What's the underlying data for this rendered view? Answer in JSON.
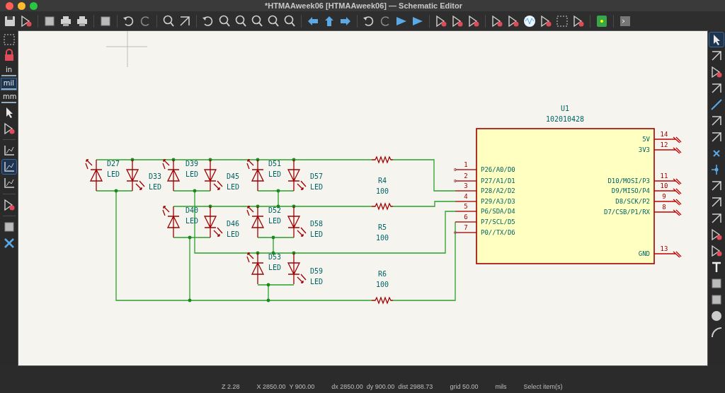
{
  "window": {
    "title": "*HTMAAweek06 [HTMAAweek06] — Schematic Editor"
  },
  "left_toolbar": {
    "units": [
      {
        "label": "in",
        "selected": false
      },
      {
        "label": "mil",
        "selected": true
      },
      {
        "label": "mm",
        "selected": false
      }
    ]
  },
  "schematic": {
    "leds": [
      {
        "ref": "D27",
        "value": "LED"
      },
      {
        "ref": "D33",
        "value": "LED"
      },
      {
        "ref": "D39",
        "value": "LED"
      },
      {
        "ref": "D45",
        "value": "LED"
      },
      {
        "ref": "D51",
        "value": "LED"
      },
      {
        "ref": "D57",
        "value": "LED"
      },
      {
        "ref": "D40",
        "value": "LED"
      },
      {
        "ref": "D46",
        "value": "LED"
      },
      {
        "ref": "D52",
        "value": "LED"
      },
      {
        "ref": "D58",
        "value": "LED"
      },
      {
        "ref": "D53",
        "value": "LED"
      },
      {
        "ref": "D59",
        "value": "LED"
      }
    ],
    "resistors": [
      {
        "ref": "R4",
        "value": "100"
      },
      {
        "ref": "R5",
        "value": "100"
      },
      {
        "ref": "R6",
        "value": "100"
      }
    ],
    "ic": {
      "ref": "U1",
      "value": "102010428",
      "pins_left": [
        {
          "number": "1",
          "name": "P26/A0/D0"
        },
        {
          "number": "2",
          "name": "P27/A1/D1"
        },
        {
          "number": "3",
          "name": "P28/A2/D2"
        },
        {
          "number": "4",
          "name": "P29/A3/D3"
        },
        {
          "number": "5",
          "name": "P6/SDA/D4"
        },
        {
          "number": "6",
          "name": "P7/SCL/D5"
        },
        {
          "number": "7",
          "name": "P0//TX/D6"
        }
      ],
      "pins_right": [
        {
          "number": "14",
          "name": "5V"
        },
        {
          "number": "12",
          "name": "3V3"
        },
        {
          "number": "11",
          "name": "D10/MOSI/P3"
        },
        {
          "number": "10",
          "name": "D9/MISO/P4"
        },
        {
          "number": "9",
          "name": "D8/SCK/P2"
        },
        {
          "number": "8",
          "name": "D7/CSB/P1/RX"
        },
        {
          "number": "13",
          "name": "GND"
        }
      ]
    }
  },
  "status_bar": [
    "Z 2.28",
    "X 2850.00  Y 900.00",
    "dx 2850.00  dy 900.00  dist 2988.73",
    "grid 50.00",
    "mils",
    "Select item(s)"
  ]
}
